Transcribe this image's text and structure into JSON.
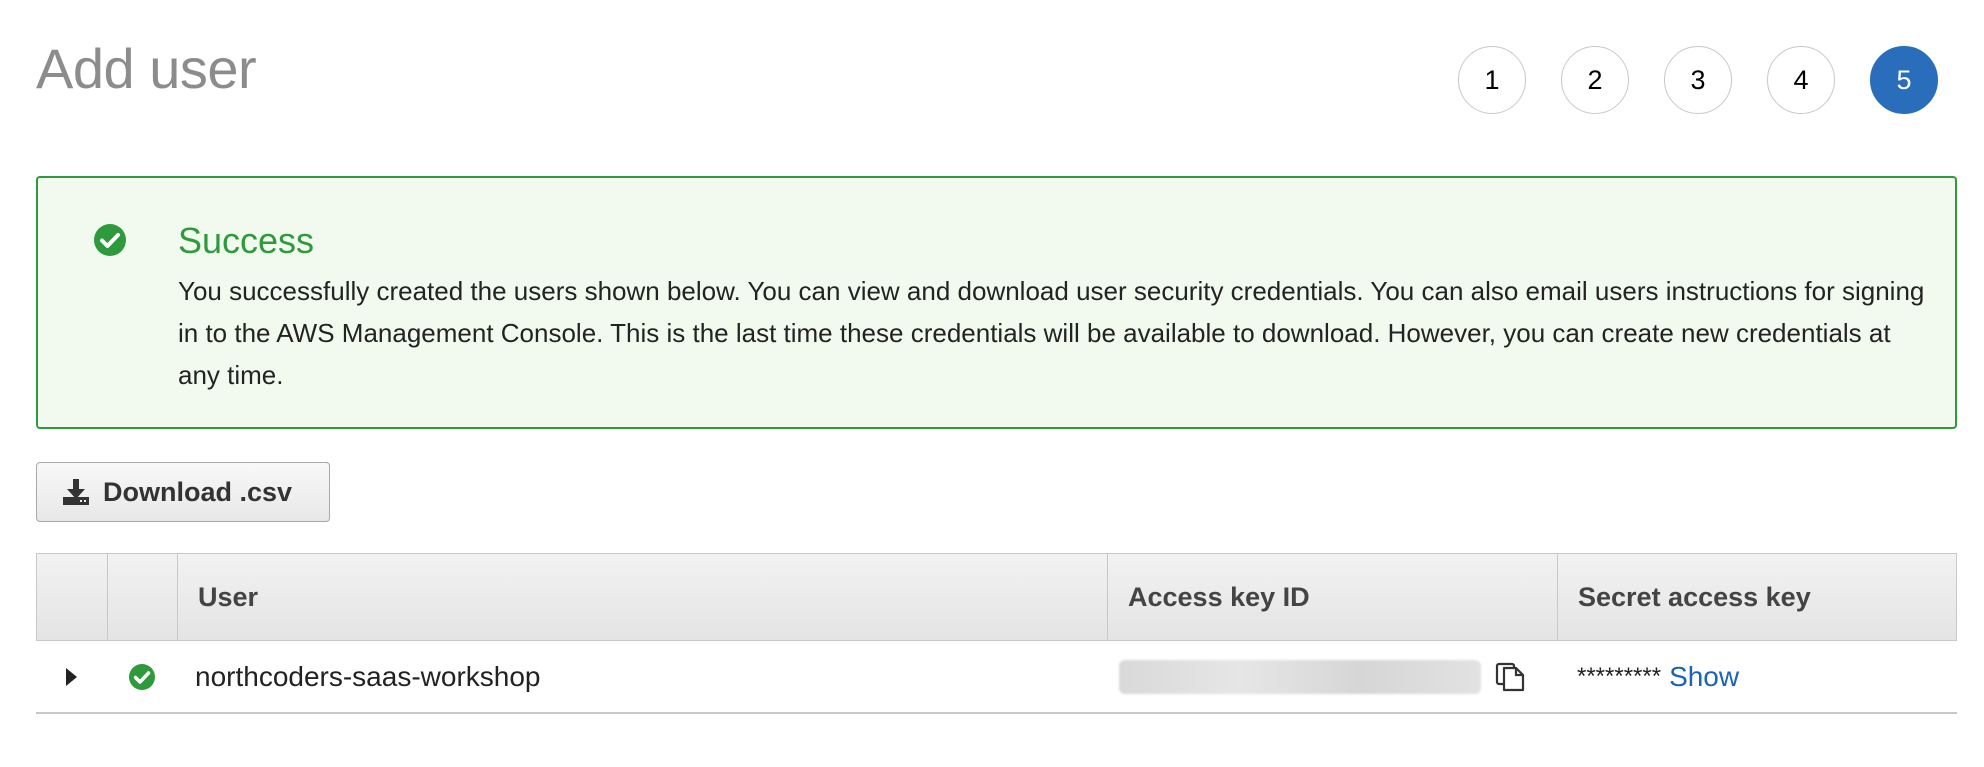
{
  "page": {
    "title": "Add user"
  },
  "steps": [
    "1",
    "2",
    "3",
    "4",
    "5"
  ],
  "alert": {
    "title": "Success",
    "message": "You successfully created the users shown below. You can view and download user security credentials. You can also email users instructions for signing in to the AWS Management Console. This is the last time these credentials will be available to download. However, you can create new credentials at any time."
  },
  "download_button": {
    "label": "Download .csv"
  },
  "table": {
    "headers": {
      "user": "User",
      "access_key_id": "Access key ID",
      "secret_access_key": "Secret access key"
    },
    "rows": [
      {
        "user": "northcoders-saas-workshop",
        "secret_mask": "*********",
        "show_label": "Show"
      }
    ]
  },
  "colors": {
    "accent": "#2a6ebb",
    "success": "#2e9a3c",
    "link": "#1a64b5"
  }
}
